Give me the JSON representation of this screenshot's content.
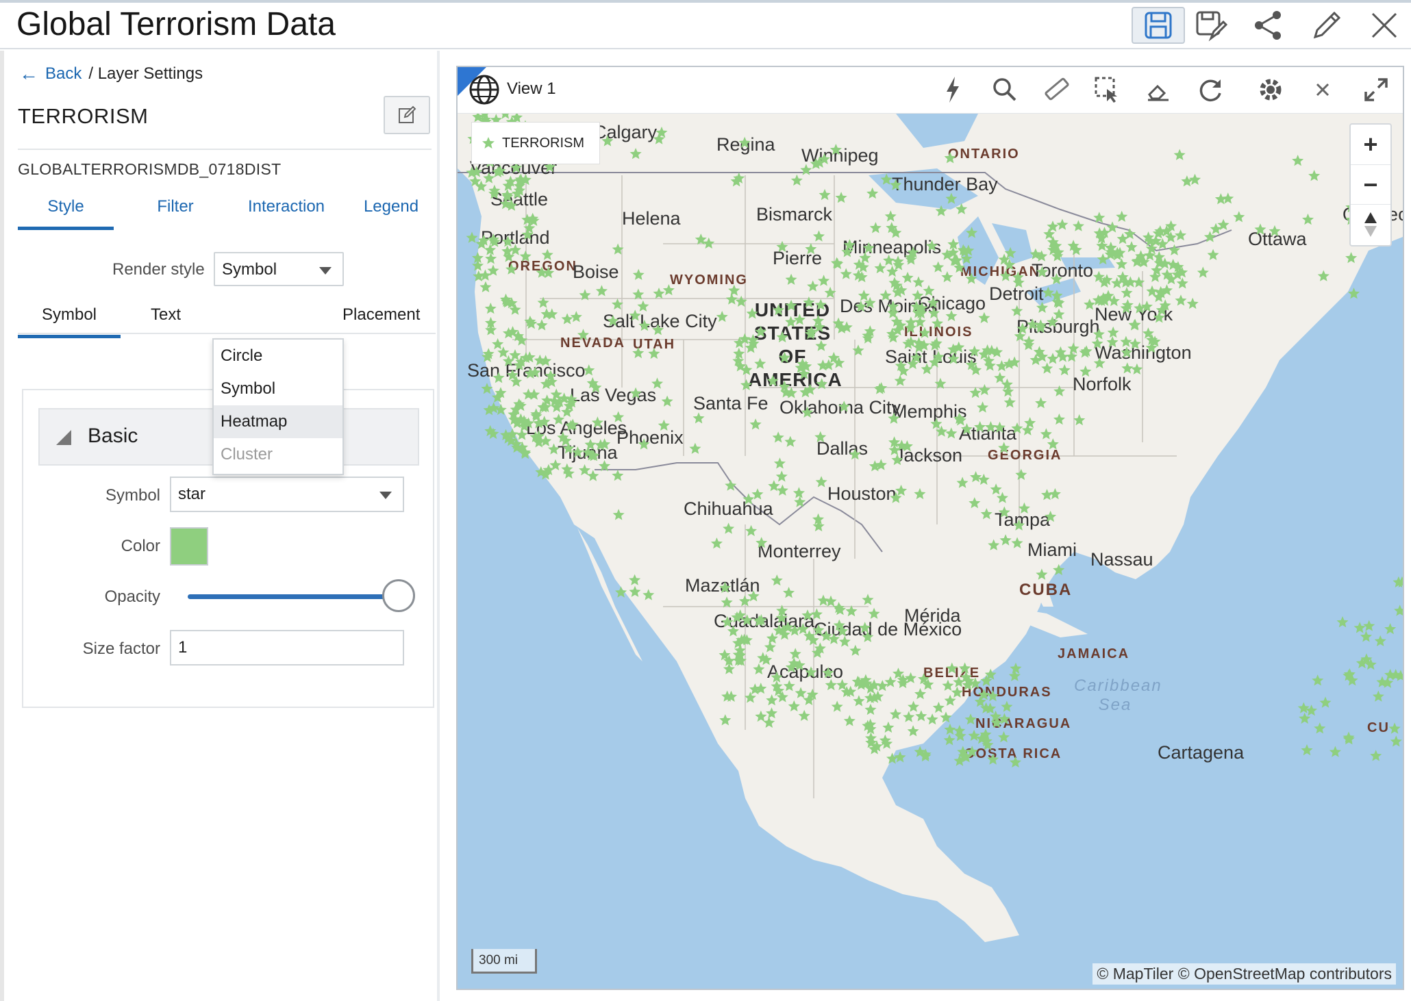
{
  "app": {
    "title": "Global Terrorism Data"
  },
  "left_panel": {
    "breadcrumb": {
      "back": "Back",
      "current": "/ Layer Settings"
    },
    "layer_name": "TERRORISM",
    "dataset": "GLOBALTERRORISMDB_0718DIST",
    "tabs": [
      "Style",
      "Filter",
      "Interaction",
      "Legend"
    ],
    "render_style": {
      "label": "Render style",
      "value": "Symbol",
      "options": [
        "Circle",
        "Symbol",
        "Heatmap",
        "Cluster"
      ]
    },
    "subtabs": [
      "Symbol",
      "Text",
      "Placement"
    ],
    "basic": {
      "title": "Basic",
      "symbol_label": "Symbol",
      "symbol_value": "star",
      "color_label": "Color",
      "color_value": "#8fcf7f",
      "opacity_label": "Opacity",
      "opacity_value": 1.0,
      "size_label": "Size factor",
      "size_value": "1"
    }
  },
  "map": {
    "view_title": "View 1",
    "legend_label": "TERRORISM",
    "scale": "300 mi",
    "attribution": "© MapTiler  © OpenStreetMap contributors",
    "labels": {
      "calgary": "Calgary",
      "regina": "Regina",
      "winnipeg": "Winnipeg",
      "ontario": "ONTARIO",
      "vancouver": "Vancouver",
      "thunder_bay": "Thunder Bay",
      "quebec": "Québec",
      "seattle": "Seattle",
      "helena": "Helena",
      "bismarck": "Bismarck",
      "portland": "Portland",
      "minneapolis": "Minneapolis",
      "ottawa": "Ottawa",
      "oregon": "OREGON",
      "boise": "Boise",
      "pierre": "Pierre",
      "wyoming": "WYOMING",
      "michigan": "MICHIGAN",
      "toronto": "Toronto",
      "des_moines": "Des Moines",
      "chicago": "Chicago",
      "detroit": "Detroit",
      "salt_lake": "Salt Lake City",
      "nevada": "NEVADA",
      "utah": "UTAH",
      "usa": "UNITED STATES OF AMERICA",
      "illinois": "ILLINOIS",
      "pittsburgh": "Pittsburgh",
      "new_york": "New York",
      "washington": "Washington",
      "san_francisco": "San Francisco",
      "saint_louis": "Saint Louis",
      "norfolk": "Norfolk",
      "las_vegas": "Las Vegas",
      "santa_fe": "Santa Fe",
      "oklahoma": "Oklahoma City",
      "memphis": "Memphis",
      "los_angeles": "Los Angeles",
      "phoenix": "Phoenix",
      "atlanta": "Atlanta",
      "tijuana": "Tijuana",
      "dallas": "Dallas",
      "jackson": "Jackson",
      "georgia": "GEORGIA",
      "houston": "Houston",
      "chihuahua": "Chihuahua",
      "tampa": "Tampa",
      "monterrey": "Monterrey",
      "miami": "Miami",
      "nassau": "Nassau",
      "mazatlan": "Mazatlán",
      "cuba": "CUBA",
      "merida": "Mérida",
      "guadalajara": "Guadalajara",
      "mexico_city": "Ciudad de México",
      "jamaica": "JAMAICA",
      "acapulco": "Acapulco",
      "belize": "BELIZE",
      "caribbean": "Caribbean Sea",
      "honduras": "HONDURAS",
      "nicaragua": "NICARAGUA",
      "costa_rica": "COSTA RICA",
      "cartagena": "Cartagena",
      "cu": "CU"
    }
  },
  "colors": {
    "accent": "#1f6ab2",
    "symbol": "#8fcf7f",
    "water": "#a6cbe9",
    "land": "#f2f0eb"
  },
  "icons": [
    "save-icon",
    "save-as-icon",
    "share-icon",
    "pencil-icon",
    "close-icon",
    "globe-icon",
    "lightning-icon",
    "search-icon",
    "ruler-icon",
    "select-icon",
    "eraser-icon",
    "refresh-icon",
    "gear-icon",
    "expand-icon"
  ]
}
